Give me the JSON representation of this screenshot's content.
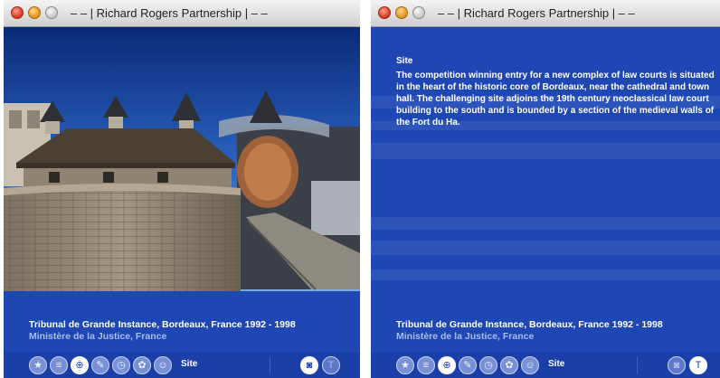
{
  "window_title": "– – | Richard Rogers Partnership | – –",
  "project": {
    "title": "Tribunal de Grande Instance, Bordeaux, France  1992 - 1998",
    "client": "Ministère de la Justice, France"
  },
  "text_panel": {
    "heading": "Site",
    "body": "The competition winning entry for a new complex of law courts is situated in the heart of the historic core of Bordeaux, near the cathedral and town hall. The challenging site adjoins the 19th century neoclassical law court building to the south and is bounded by a section of the medieval walls of the Fort du Ha."
  },
  "toolbar": {
    "section_label": "Site",
    "nav_icons": [
      "star-icon",
      "list-icon",
      "crosshair-icon",
      "pen-icon",
      "clock-icon",
      "flower-icon",
      "people-icon"
    ],
    "active_nav_index": 2,
    "text_button_label": "T",
    "camera_glyph": "◙"
  },
  "colors": {
    "window_bg": "#1e47b4",
    "toolbar_bg": "#1a3fa6",
    "subtitle": "#a9bde9"
  }
}
